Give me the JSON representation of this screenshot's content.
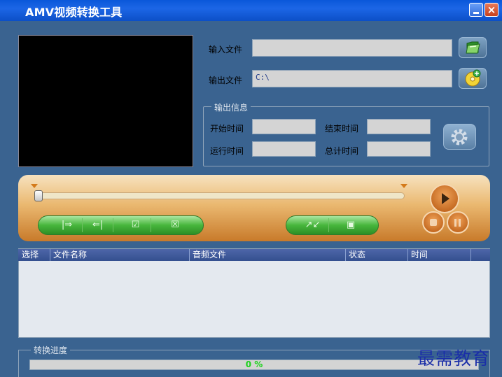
{
  "window": {
    "title": "AMV视频转换工具"
  },
  "input": {
    "label": "输入文件",
    "value": ""
  },
  "output": {
    "label": "输出文件",
    "value": "C:\\"
  },
  "output_info": {
    "title": "输出信息",
    "start_label": "开始时间",
    "start_value": "",
    "end_label": "结束时间",
    "end_value": "",
    "run_label": "运行时间",
    "run_value": "",
    "total_label": "总计时间",
    "total_value": ""
  },
  "player": {
    "position": 0.0
  },
  "controls": {
    "left_group": [
      "|⇒",
      "⇐|",
      "☑",
      "☒"
    ],
    "right_group": [
      "↗↙",
      "▣"
    ]
  },
  "list": {
    "columns": [
      "选择",
      "文件名称",
      "音频文件",
      "状态",
      "时间"
    ]
  },
  "progress": {
    "title": "转换进度",
    "value_text": "0 %",
    "percent": 0
  },
  "watermark": {
    "text": "最需教育"
  },
  "icons": {
    "open_input": "folder-open-icon",
    "open_output": "disc-icon",
    "settings": "gear-icon"
  }
}
